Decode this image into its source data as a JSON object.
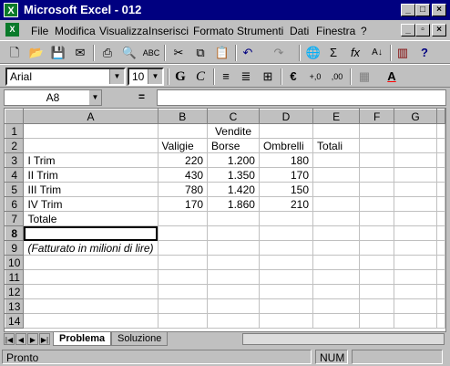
{
  "window": {
    "title": "Microsoft Excel - 012"
  },
  "menu": [
    "File",
    "Modifica",
    "Visualizza",
    "Inserisci",
    "Formato",
    "Strumenti",
    "Dati",
    "Finestra",
    "?"
  ],
  "format": {
    "font": "Arial",
    "size": "10",
    "bold": "G",
    "italic": "C",
    "currency": "€"
  },
  "formula_bar": {
    "cell": "A8",
    "equals": "=",
    "value": ""
  },
  "columns": [
    "A",
    "B",
    "C",
    "D",
    "E",
    "F",
    "G"
  ],
  "rows": [
    {
      "n": "1",
      "cells": [
        "",
        "",
        "Vendite",
        "",
        "",
        "",
        ""
      ]
    },
    {
      "n": "2",
      "cells": [
        "",
        "Valigie",
        "Borse",
        "Ombrelli",
        "Totali",
        "",
        ""
      ]
    },
    {
      "n": "3",
      "cells": [
        "I Trim",
        "220",
        "1.200",
        "180",
        "",
        "",
        ""
      ]
    },
    {
      "n": "4",
      "cells": [
        "II Trim",
        "430",
        "1.350",
        "170",
        "",
        "",
        ""
      ]
    },
    {
      "n": "5",
      "cells": [
        "III Trim",
        "780",
        "1.420",
        "150",
        "",
        "",
        ""
      ]
    },
    {
      "n": "6",
      "cells": [
        "IV Trim",
        "170",
        "1.860",
        "210",
        "",
        "",
        ""
      ]
    },
    {
      "n": "7",
      "cells": [
        "Totale",
        "",
        "",
        "",
        "",
        "",
        ""
      ]
    },
    {
      "n": "8",
      "cells": [
        "",
        "",
        "",
        "",
        "",
        "",
        ""
      ]
    },
    {
      "n": "9",
      "cells": [
        "(Fatturato in milioni di lire)",
        "",
        "",
        "",
        "",
        "",
        ""
      ]
    },
    {
      "n": "10",
      "cells": [
        "",
        "",
        "",
        "",
        "",
        "",
        ""
      ]
    },
    {
      "n": "11",
      "cells": [
        "",
        "",
        "",
        "",
        "",
        "",
        ""
      ]
    },
    {
      "n": "12",
      "cells": [
        "",
        "",
        "",
        "",
        "",
        "",
        ""
      ]
    },
    {
      "n": "13",
      "cells": [
        "",
        "",
        "",
        "",
        "",
        "",
        ""
      ]
    },
    {
      "n": "14",
      "cells": [
        "",
        "",
        "",
        "",
        "",
        "",
        ""
      ]
    }
  ],
  "sheets": [
    "Problema",
    "Soluzione"
  ],
  "status": {
    "mode": "Pronto",
    "num": "NUM"
  }
}
